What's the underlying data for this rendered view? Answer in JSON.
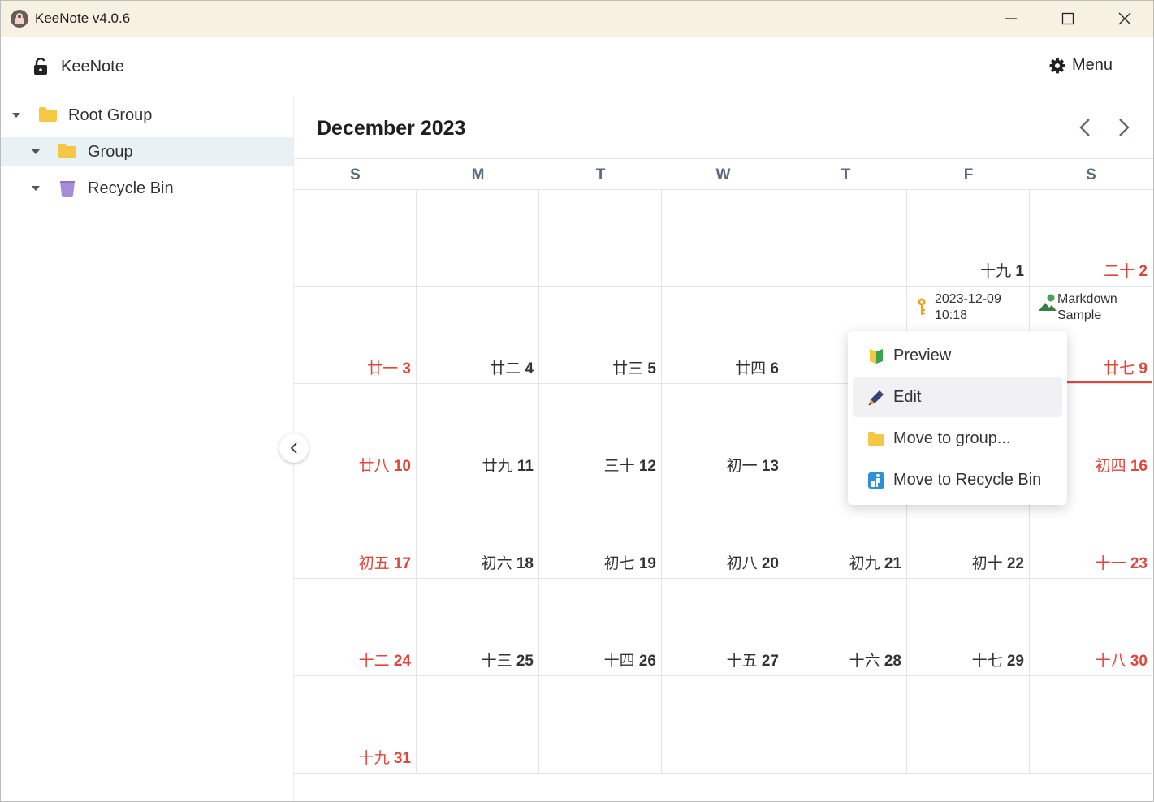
{
  "window": {
    "title": "KeeNote v4.0.6"
  },
  "header": {
    "app_name": "KeeNote",
    "menu_label": "Menu"
  },
  "sidebar": {
    "items": [
      {
        "label": "Root Group",
        "icon": "folder-icon"
      },
      {
        "label": "Group",
        "icon": "folder-icon",
        "selected": true
      },
      {
        "label": "Recycle Bin",
        "icon": "recycle-bin-icon"
      }
    ]
  },
  "calendar": {
    "title": "December 2023",
    "weekdays": [
      "S",
      "M",
      "T",
      "W",
      "T",
      "F",
      "S"
    ],
    "weeks": [
      [
        null,
        null,
        null,
        null,
        null,
        {
          "lunar": "十九",
          "day": "1"
        },
        {
          "lunar": "二十",
          "day": "2"
        }
      ],
      [
        {
          "lunar": "廿一",
          "day": "3"
        },
        {
          "lunar": "廿二",
          "day": "4"
        },
        {
          "lunar": "廿三",
          "day": "5"
        },
        {
          "lunar": "廿四",
          "day": "6"
        },
        null,
        null,
        {
          "lunar": "廿七",
          "day": "9"
        }
      ],
      [
        {
          "lunar": "廿八",
          "day": "10"
        },
        {
          "lunar": "廿九",
          "day": "11"
        },
        {
          "lunar": "三十",
          "day": "12"
        },
        {
          "lunar": "初一",
          "day": "13"
        },
        null,
        null,
        {
          "lunar": "初四",
          "day": "16"
        }
      ],
      [
        {
          "lunar": "初五",
          "day": "17"
        },
        {
          "lunar": "初六",
          "day": "18"
        },
        {
          "lunar": "初七",
          "day": "19"
        },
        {
          "lunar": "初八",
          "day": "20"
        },
        {
          "lunar": "初九",
          "day": "21"
        },
        {
          "lunar": "初十",
          "day": "22"
        },
        {
          "lunar": "十一",
          "day": "23"
        }
      ],
      [
        {
          "lunar": "十二",
          "day": "24"
        },
        {
          "lunar": "十三",
          "day": "25"
        },
        {
          "lunar": "十四",
          "day": "26"
        },
        {
          "lunar": "十五",
          "day": "27"
        },
        {
          "lunar": "十六",
          "day": "28"
        },
        {
          "lunar": "十七",
          "day": "29"
        },
        {
          "lunar": "十八",
          "day": "30"
        }
      ],
      [
        {
          "lunar": "十九",
          "day": "31"
        },
        null,
        null,
        null,
        null,
        null,
        null
      ]
    ],
    "events": [
      {
        "line1": "2023-12-09",
        "line2": "10:18",
        "icon": "key-icon"
      },
      {
        "line1": "Markdown",
        "line2": "Sample",
        "icon": "image-icon"
      }
    ]
  },
  "context_menu": {
    "items": [
      {
        "label": "Preview",
        "icon": "preview-icon"
      },
      {
        "label": "Edit",
        "icon": "pen-icon",
        "active": true
      },
      {
        "label": "Move to group...",
        "icon": "folder-icon"
      },
      {
        "label": "Move to Recycle Bin",
        "icon": "recycle-bin-icon"
      }
    ]
  },
  "colors": {
    "titlebar": "#f7f1e1",
    "weekend": "#e0463c",
    "selected_row": "#e8f1f3",
    "folder": "#f6c744"
  }
}
